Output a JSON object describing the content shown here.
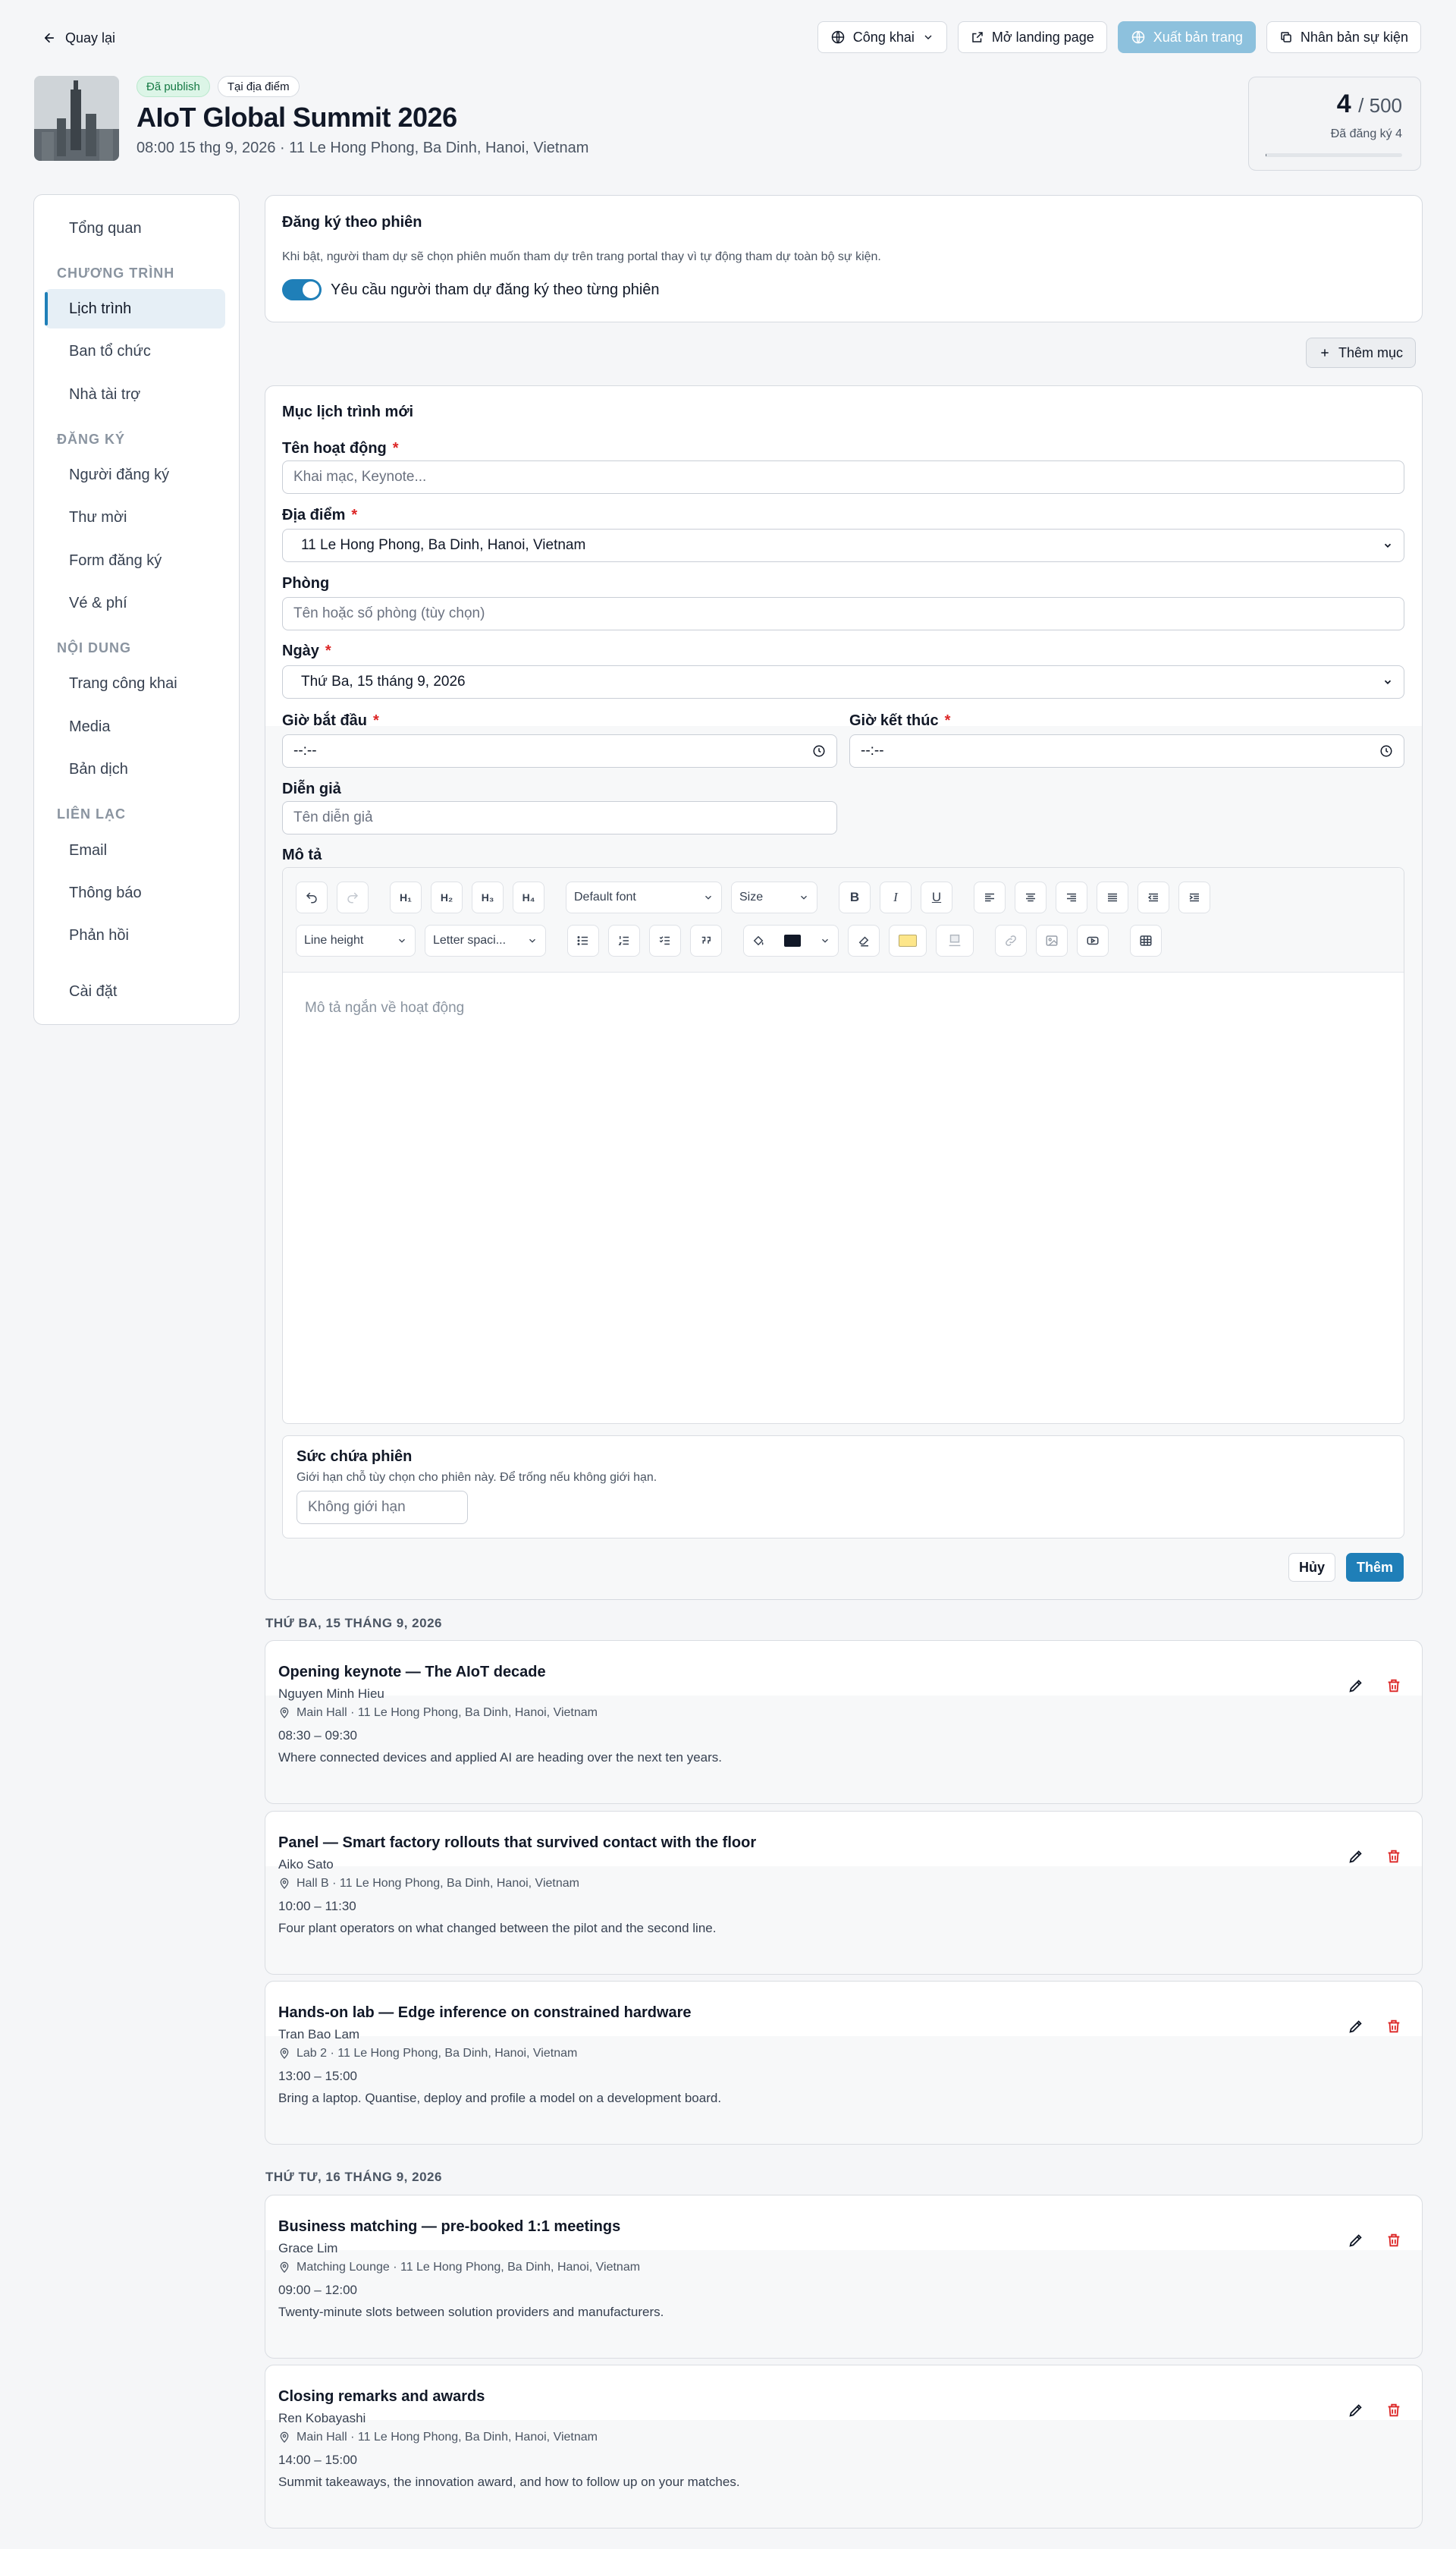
{
  "topbar": {
    "back_label": "Quay lại",
    "visibility_label": "Công khai",
    "open_landing_label": "Mở landing page",
    "publish_label": "Xuất bản trang",
    "duplicate_label": "Nhân bản sự kiện"
  },
  "event": {
    "badge_status": "Đã publish",
    "badge_mode": "Tại địa điểm",
    "title": "AIoT Global Summit 2026",
    "subtitle": "08:00 15 thg 9, 2026 · 11 Le Hong Phong, Ba Dinh, Hanoi, Vietnam"
  },
  "registration": {
    "count": "4",
    "capacity": "/ 500",
    "label": "Đã đăng ký 4",
    "fill_fraction": 0.008
  },
  "sidebar": {
    "overview": "Tổng quan",
    "group_program": "CHƯƠNG TRÌNH",
    "schedule": "Lịch trình",
    "organizers": "Ban tổ chức",
    "sponsors": "Nhà tài trợ",
    "group_registration": "ĐĂNG KÝ",
    "registrants": "Người đăng ký",
    "invitations": "Thư mời",
    "reg_form": "Form đăng ký",
    "tickets": "Vé & phí",
    "group_content": "NỘI DUNG",
    "public_page": "Trang công khai",
    "media": "Media",
    "translations": "Bản dịch",
    "group_contact": "LIÊN LẠC",
    "email": "Email",
    "notifications": "Thông báo",
    "feedback": "Phản hồi",
    "settings": "Cài đặt"
  },
  "session_reg": {
    "title": "Đăng ký theo phiên",
    "desc": "Khi bật, người tham dự sẽ chọn phiên muốn tham dự trên trang portal thay vì tự động tham dự toàn bộ sự kiện.",
    "toggle_label": "Yêu cầu người tham dự đăng ký theo từng phiên"
  },
  "add_item_label": "Thêm mục",
  "form": {
    "title": "Mục lịch trình mới",
    "name_label": "Tên hoạt động",
    "name_placeholder": "Khai mạc, Keynote...",
    "location_label": "Địa điểm",
    "location_value": "11 Le Hong Phong, Ba Dinh, Hanoi, Vietnam",
    "room_label": "Phòng",
    "room_placeholder": "Tên hoặc số phòng (tùy chọn)",
    "date_label": "Ngày",
    "date_value": "Thứ Ba, 15 tháng 9, 2026",
    "start_label": "Giờ bắt đầu",
    "end_label": "Giờ kết thúc",
    "time_placeholder": "--:--",
    "speaker_label": "Diễn giả",
    "speaker_placeholder": "Tên diễn giả",
    "desc_label": "Mô tả",
    "editor_placeholder": "Mô tả ngắn về hoạt động",
    "font_select": "Default font",
    "size_select": "Size",
    "line_height_select": "Line height",
    "letter_spacing_select": "Letter spaci...",
    "text_color": "#111827",
    "highlight_color": "#fde68a",
    "capacity_title": "Sức chứa phiên",
    "capacity_desc": "Giới hạn chỗ tùy chọn cho phiên này. Để trống nếu không giới hạn.",
    "capacity_placeholder": "Không giới hạn",
    "cancel_label": "Hủy",
    "submit_label": "Thêm"
  },
  "days": [
    {
      "heading": "THỨ BA, 15 THÁNG 9, 2026",
      "sessions": [
        {
          "title": "Opening keynote — The AIoT decade",
          "speaker": "Nguyen Minh Hieu",
          "location": "Main Hall · 11 Le Hong Phong, Ba Dinh, Hanoi, Vietnam",
          "time": "08:30 – 09:30",
          "desc": "Where connected devices and applied AI are heading over the next ten years."
        },
        {
          "title": "Panel — Smart factory rollouts that survived contact with the floor",
          "speaker": "Aiko Sato",
          "location": "Hall B · 11 Le Hong Phong, Ba Dinh, Hanoi, Vietnam",
          "time": "10:00 – 11:30",
          "desc": "Four plant operators on what changed between the pilot and the second line."
        },
        {
          "title": "Hands-on lab — Edge inference on constrained hardware",
          "speaker": "Tran Bao Lam",
          "location": "Lab 2 · 11 Le Hong Phong, Ba Dinh, Hanoi, Vietnam",
          "time": "13:00 – 15:00",
          "desc": "Bring a laptop. Quantise, deploy and profile a model on a development board."
        }
      ]
    },
    {
      "heading": "THỨ TƯ, 16 THÁNG 9, 2026",
      "sessions": [
        {
          "title": "Business matching — pre-booked 1:1 meetings",
          "speaker": "Grace Lim",
          "location": "Matching Lounge · 11 Le Hong Phong, Ba Dinh, Hanoi, Vietnam",
          "time": "09:00 – 12:00",
          "desc": "Twenty-minute slots between solution providers and manufacturers."
        },
        {
          "title": "Closing remarks and awards",
          "speaker": "Ren Kobayashi",
          "location": "Main Hall · 11 Le Hong Phong, Ba Dinh, Hanoi, Vietnam",
          "time": "14:00 – 15:00",
          "desc": "Summit takeaways, the innovation award, and how to follow up on your matches."
        }
      ]
    }
  ]
}
